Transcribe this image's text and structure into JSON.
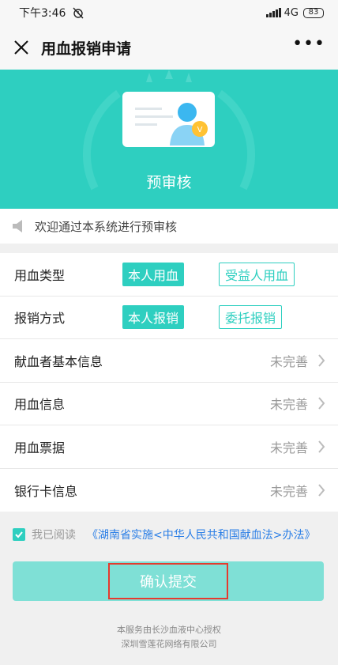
{
  "status_bar": {
    "time": "下午3:46",
    "network": "4G",
    "battery": "83"
  },
  "header": {
    "title": "用血报销申请"
  },
  "hero": {
    "label": "预审核"
  },
  "notice": {
    "text": "欢迎通过本系统进行预审核"
  },
  "form": {
    "blood_type": {
      "label": "用血类型",
      "options": [
        "本人用血",
        "受益人用血"
      ],
      "selected": "本人用血"
    },
    "reimburse_method": {
      "label": "报销方式",
      "options": [
        "本人报销",
        "委托报销"
      ],
      "selected": "本人报销"
    },
    "rows": [
      {
        "label": "献血者基本信息",
        "status": "未完善"
      },
      {
        "label": "用血信息",
        "status": "未完善"
      },
      {
        "label": "用血票据",
        "status": "未完善"
      },
      {
        "label": "银行卡信息",
        "status": "未完善"
      }
    ]
  },
  "agreement": {
    "checked": true,
    "read_label": "我已阅读",
    "link_text": "《湖南省实施<中华人民共和国献血法>办法》"
  },
  "submit": {
    "label": "确认提交"
  },
  "footer": {
    "line1": "本服务由长沙血液中心授权",
    "line2": "深圳雪莲花网络有限公司"
  },
  "colors": {
    "accent": "#2ecfc0",
    "link": "#2a7ee6",
    "highlight": "#e53a2e"
  }
}
